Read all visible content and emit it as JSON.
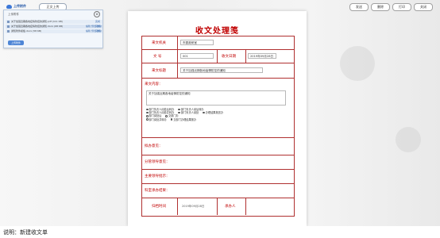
{
  "topbar": {
    "upload_label": "上传附件",
    "tab_label": "正文上传",
    "buttons": [
      "发送",
      "删除",
      "打印",
      "关闭"
    ]
  },
  "upload_panel": {
    "title": "上传附件",
    "close_glyph": "⊗",
    "files": [
      {
        "name": "关于加强近期各地疫情防控的通知.pdf (111 KB)",
        "meta": "",
        "status": "完成"
      },
      {
        "name": "关于加强近期各地疫情防控的通知.docx (68 KB)",
        "meta": "编辑 预览 删除",
        "status": "完成"
      },
      {
        "name": "通知附件模板.docx (58 KB)",
        "meta": "编辑 预览 删除",
        "status": "完成"
      }
    ],
    "upload_button": "上传附件"
  },
  "document": {
    "title": "收文处理笺 ",
    "labels": {
      "doc_name": "来文机关",
      "doc_number": "文  号",
      "receive_date": "收文日期",
      "subject": "来文标题",
      "content": "来文内容：",
      "handling_opinion": "拟办意见：",
      "leader_opinion": "分管领导意见：",
      "main_leader_opinion": "主要领导批示：",
      "result": "科室承办结果：",
      "archive_date": "归档时间",
      "handler": "承办人"
    },
    "values": {
      "doc_name": "市委政研室",
      "doc_number": "001",
      "receive_date": "2019年09月28日",
      "subject": "关于加强近期各地疫情防控的通知",
      "content": "关于加强近期各地疫情防控的通知",
      "archive_date": "2019年09月28日",
      "handler": ""
    },
    "options": [
      [
        "部门负责人阅处后转办",
        "部门负责人阅后转办"
      ],
      [
        "部门负责人阅处并转办",
        "部门负责人阅处",
        "办理结果报送办"
      ],
      [
        "部门阅处后",
        "交部门办"
      ],
      [
        "部门阅处并转办",
        "交部门办理结果报办"
      ]
    ]
  },
  "caption": "说明：新建收文单"
}
